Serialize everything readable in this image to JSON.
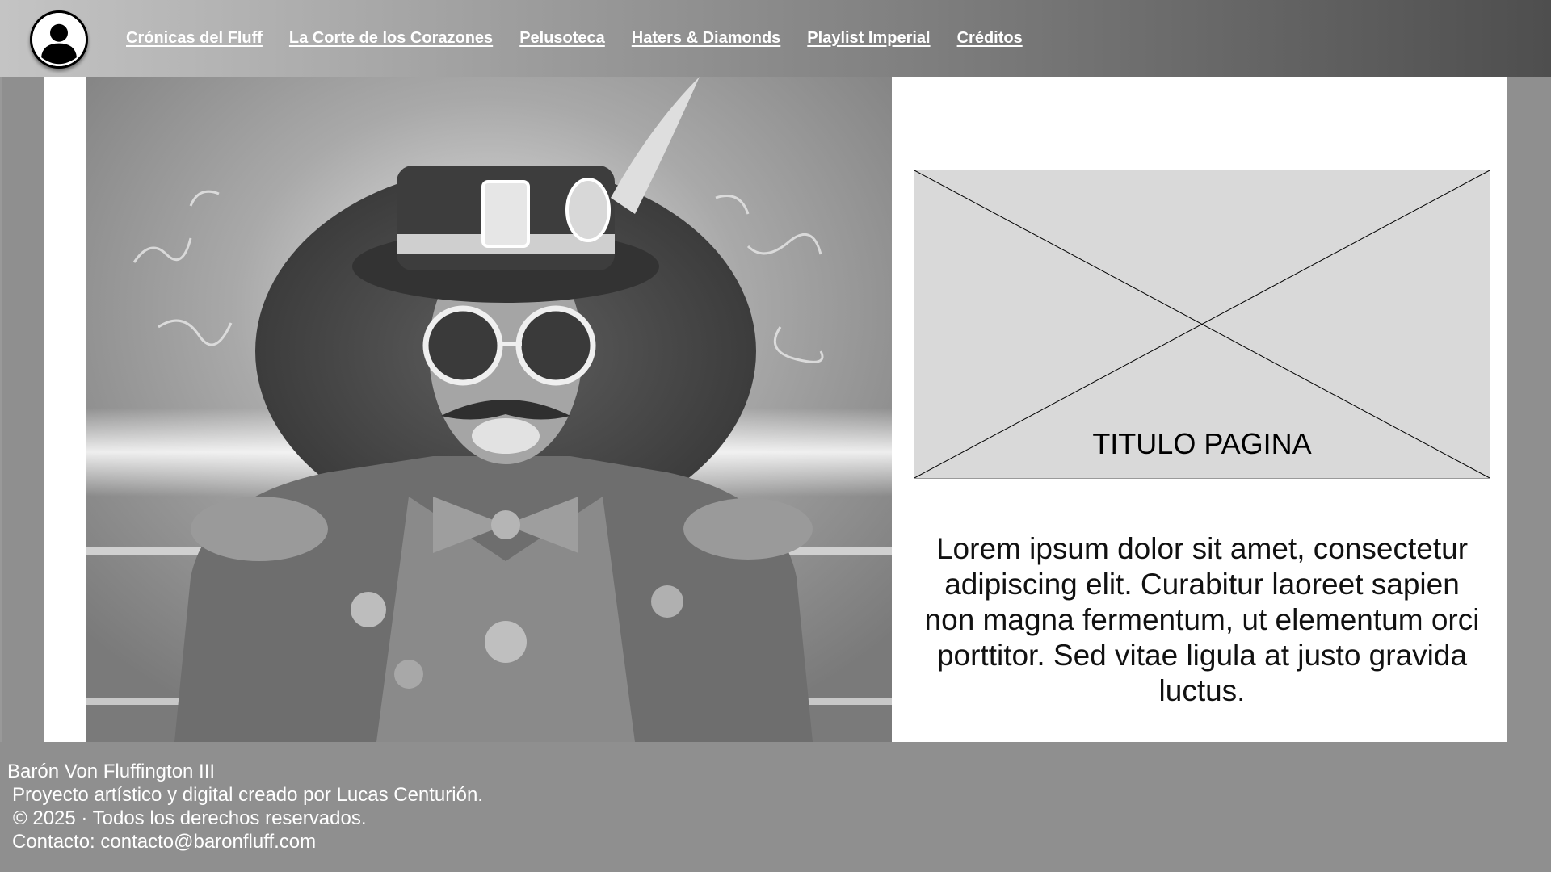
{
  "nav": {
    "avatar_icon": "user-profile-icon",
    "links": [
      {
        "label": "Crónicas del Fluff"
      },
      {
        "label": "La Corte de los Corazones"
      },
      {
        "label": "Pelusoteca"
      },
      {
        "label": "Haters & Diamonds"
      },
      {
        "label": "Playlist Imperial"
      },
      {
        "label": "Créditos"
      }
    ]
  },
  "hero": {
    "image_icon": "hero-portrait-image"
  },
  "placeholder": {
    "title": "TITULO PAGINA"
  },
  "body": {
    "text": "Lorem ipsum dolor sit amet, consectetur adipiscing elit. Curabitur laoreet sapien non magna fermentum, ut elementum orci porttitor. Sed vitae ligula at justo gravida luctus."
  },
  "footer": {
    "name": "Barón Von Fluffington III",
    "credit": "Proyecto artístico y digital creado por Lucas Centurión.",
    "copyright": "© 2025 · Todos los derechos reservados.",
    "contact": "Contacto: contacto@baronfluff.com"
  },
  "colors": {
    "background": "#8f8f8f",
    "content": "#ffffff",
    "placeholder": "#d9d9d9",
    "nav_text": "#ffffff"
  }
}
